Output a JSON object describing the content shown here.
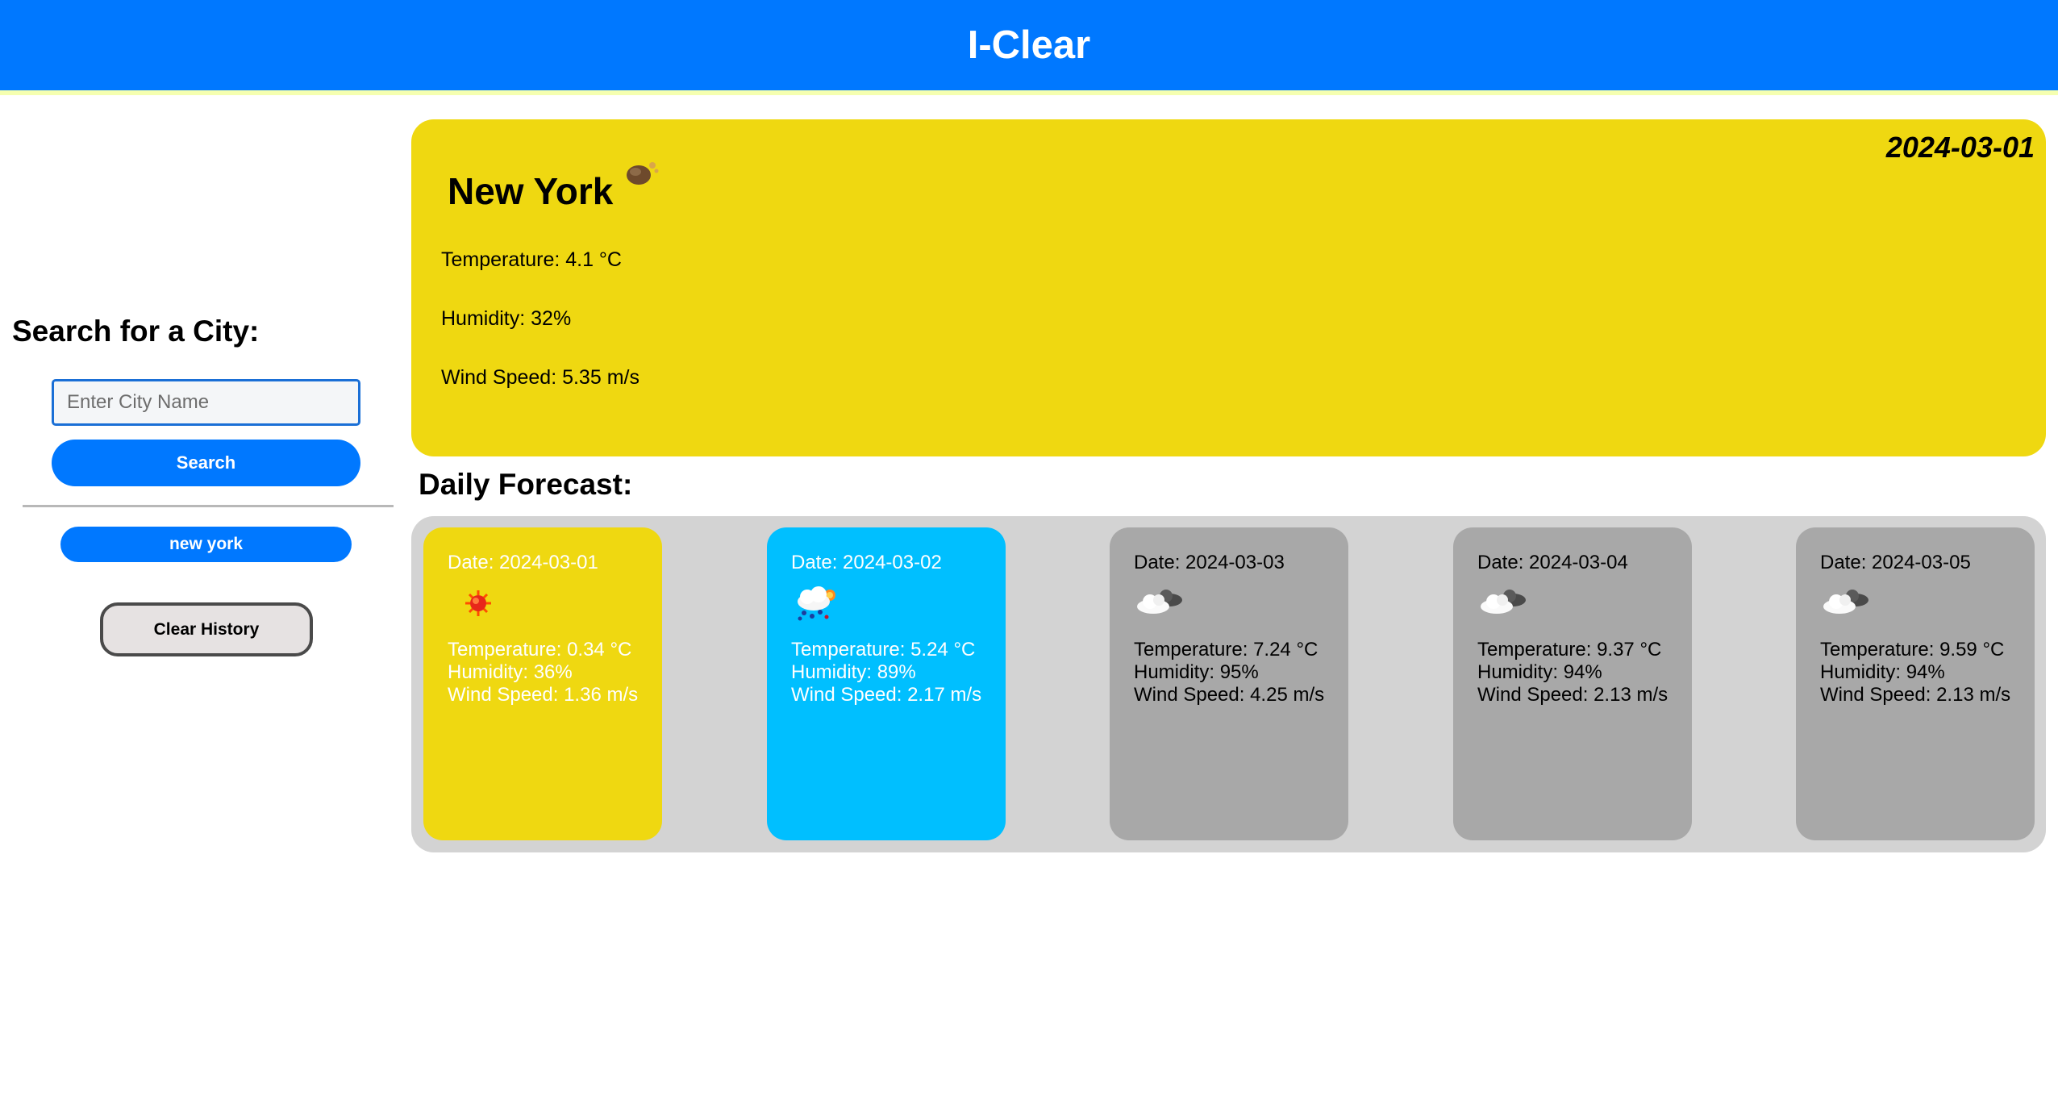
{
  "app": {
    "title": "I-Clear"
  },
  "sidebar": {
    "heading": "Search for a City:",
    "search_placeholder": "Enter City Name",
    "search_value": "",
    "search_button": "Search",
    "history": [
      "new york"
    ],
    "clear_button": "Clear History"
  },
  "current": {
    "city": "New York",
    "date": "2024-03-01",
    "icon": "moon-clouds-icon",
    "temperature": "Temperature: 4.1 °C",
    "humidity": "Humidity: 32%",
    "wind": "Wind Speed: 5.35 m/s"
  },
  "forecast": {
    "title": "Daily Forecast:",
    "days": [
      {
        "date": "Date: 2024-03-01",
        "icon": "sun-icon",
        "temperature": "Temperature: 0.34 °C",
        "humidity": "Humidity: 36%",
        "wind": "Wind Speed: 1.36 m/s",
        "color": "#EFD811"
      },
      {
        "date": "Date: 2024-03-02",
        "icon": "rain-cloud-icon",
        "temperature": "Temperature: 5.24 °C",
        "humidity": "Humidity: 89%",
        "wind": "Wind Speed: 2.17 m/s",
        "color": "#00BFFF"
      },
      {
        "date": "Date: 2024-03-03",
        "icon": "clouds-icon",
        "temperature": "Temperature: 7.24 °C",
        "humidity": "Humidity: 95%",
        "wind": "Wind Speed: 4.25 m/s",
        "color": "#A8A8A8"
      },
      {
        "date": "Date: 2024-03-04",
        "icon": "clouds-icon",
        "temperature": "Temperature: 9.37 °C",
        "humidity": "Humidity: 94%",
        "wind": "Wind Speed: 2.13 m/s",
        "color": "#A8A8A8"
      },
      {
        "date": "Date: 2024-03-05",
        "icon": "clouds-icon",
        "temperature": "Temperature: 9.59 °C",
        "humidity": "Humidity: 94%",
        "wind": "Wind Speed: 2.13 m/s",
        "color": "#A8A8A8"
      }
    ]
  },
  "colors": {
    "header": "#0078FF",
    "current_card": "#EFD811",
    "forecast_container": "#D3D3D3"
  }
}
